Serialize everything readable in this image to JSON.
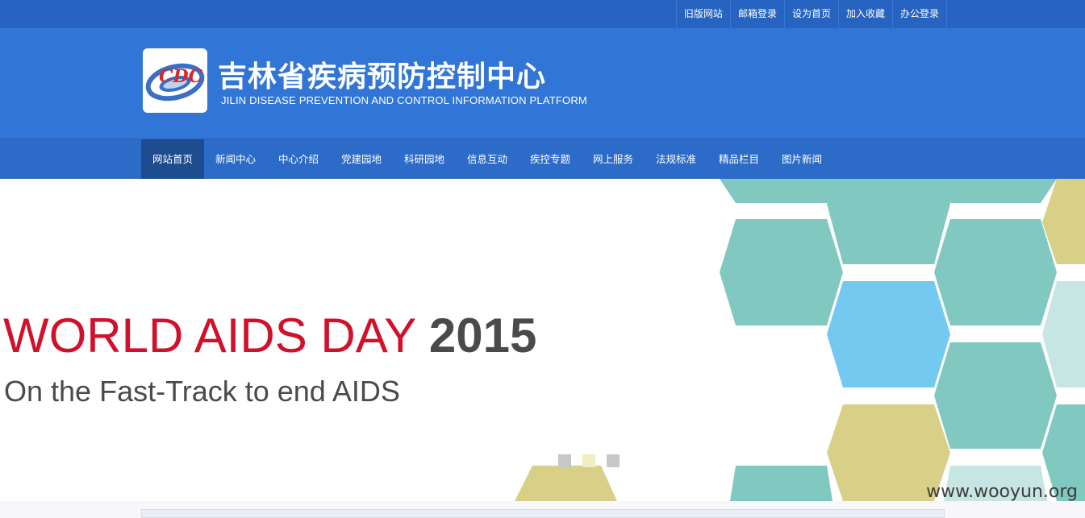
{
  "top_links": [
    "旧版网站",
    "邮箱登录",
    "设为首页",
    "加入收藏",
    "办公登录"
  ],
  "header": {
    "title": "吉林省疾病预防控制中心",
    "subtitle": "JILIN DISEASE PREVENTION AND CONTROL INFORMATION PLATFORM",
    "logo_text": "CDC"
  },
  "nav": {
    "items": [
      "网站首页",
      "新闻中心",
      "中心介绍",
      "党建园地",
      "科研园地",
      "信息互动",
      "疾控专题",
      "网上服务",
      "法规标准",
      "精品栏目",
      "图片新闻"
    ],
    "active_index": 0
  },
  "banner": {
    "headline_red": "WORLD AIDS DAY",
    "headline_year": "2015",
    "tagline": "On the Fast-Track to end AIDS",
    "slide_count": 3,
    "active_slide": 1
  },
  "watermark": "www.wooyun.org",
  "colors": {
    "topbar": "#2763c0",
    "header": "#3175d6",
    "nav": "#2d6bc9",
    "nav_active": "#1f4c8f",
    "headline_red": "#d1102b",
    "hex_teal": "#80c8c0",
    "hex_blue": "#74c9f0",
    "hex_olive": "#d8d087",
    "hex_pale": "#c7e5e2"
  }
}
